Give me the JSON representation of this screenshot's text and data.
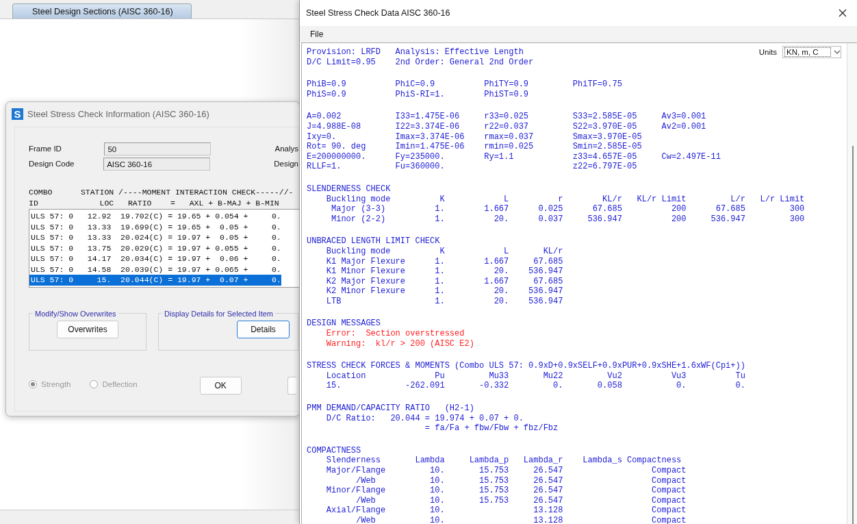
{
  "back_window": {
    "tab": {
      "label": "Steel Design Sections  (AISC 360-16)",
      "selected": true
    }
  },
  "info_dialog": {
    "app_icon": "S",
    "title": "Steel Stress Check Information (AISC 360-16)",
    "fields": [
      {
        "label": "Frame ID",
        "value": "50",
        "side_label": "Analys"
      },
      {
        "label": "Design Code",
        "value": "AISC 360-16",
        "side_label": "Design"
      }
    ],
    "table": {
      "header": [
        "COMBO      STATION /----MOMENT INTERACTION CHECK-----//-",
        "ID             LOC   RATIO    =   AXL + B-MAJ + B-MIN"
      ],
      "rows": [
        {
          "text": "ULS 57: 0   12.92  19.702(C) = 19.65 + 0.054 +     0.",
          "selected": false
        },
        {
          "text": "ULS 57: 0   13.33  19.699(C) = 19.65 +  0.05 +     0.",
          "selected": false
        },
        {
          "text": "ULS 57: 0   13.33  20.024(C) = 19.97 +  0.05 +     0.",
          "selected": false
        },
        {
          "text": "ULS 57: 0   13.75  20.029(C) = 19.97 + 0.055 +     0.",
          "selected": false
        },
        {
          "text": "ULS 57: 0   14.17  20.034(C) = 19.97 +  0.06 +     0.",
          "selected": false
        },
        {
          "text": "ULS 57: 0   14.58  20.039(C) = 19.97 + 0.065 +     0.",
          "selected": false
        },
        {
          "text": "ULS 57: 0     15.  20.044(C) = 19.97 +  0.07 +     0.",
          "selected": true
        }
      ]
    },
    "groups": [
      {
        "title": "Modify/Show Overwrites",
        "button": "Overwrites",
        "focused": false
      },
      {
        "title": "Display Details for Selected Item",
        "button": "Details",
        "focused": true
      }
    ],
    "options": {
      "disabled": true,
      "items": [
        {
          "label": "Strength",
          "selected": true
        },
        {
          "label": "Deflection",
          "selected": false
        }
      ]
    },
    "ok_button": "OK"
  },
  "data_window": {
    "title": "Steel Stress Check Data  AISC 360-16",
    "menu": [
      "File"
    ],
    "units": {
      "label": "Units",
      "value": "KN, m, C"
    },
    "report": [
      {
        "kind": "info",
        "lines": [
          "Provision: LRFD   Analysis: Effective Length",
          "D/C Limit=0.95    2nd Order: General 2nd Order"
        ]
      },
      {
        "kind": "info",
        "lines": [
          "PhiB=0.9          PhiC=0.9          PhiTY=0.9         PhiTF=0.75",
          "PhiS=0.9          PhiS-RI=1.        PhiST=0.9"
        ]
      },
      {
        "kind": "info",
        "lines": [
          "A=0.002           I33=1.475E-06     r33=0.025         S33=2.585E-05     Av3=0.001",
          "J=4.988E-08       I22=3.374E-06     r22=0.037         S22=3.970E-05     Av2=0.001",
          "Ixy=0.            Imax=3.374E-06    rmax=0.037        Smax=3.970E-05",
          "Rot= 90. deg      Imin=1.475E-06    rmin=0.025        Smin=2.585E-05",
          "E=200000000.      Fy=235000.        Ry=1.1            z33=4.657E-05     Cw=2.497E-11",
          "RLLF=1.           Fu=360000.                          z22=6.797E-05"
        ]
      },
      {
        "kind": "info",
        "heading": "SLENDERNESS CHECK",
        "lines": [
          "    Buckling mode          K            L          r        KL/r   KL/r Limit         L/r   L/r Limit",
          "     Major (3-3)          1.        1.667      0.025      67.685          200      67.685         300",
          "     Minor (2-2)          1.          20.      0.037     536.947          200     536.947         300"
        ]
      },
      {
        "kind": "info",
        "heading": "UNBRACED LENGTH LIMIT CHECK",
        "lines": [
          "    Buckling mode          K            L       KL/r",
          "    K1 Major Flexure      1.        1.667     67.685",
          "    K1 Minor Flexure      1.          20.    536.947",
          "    K2 Major Flexure      1.        1.667     67.685",
          "    K2 Minor Flexure      1.          20.    536.947",
          "    LTB                   1.          20.    536.947"
        ]
      },
      {
        "kind": "alert",
        "heading": "DESIGN MESSAGES",
        "lines": [
          "    Error:  Section overstressed",
          "    Warning:  kl/r > 200 (AISC E2)"
        ]
      },
      {
        "kind": "info",
        "heading": "STRESS CHECK FORCES & MOMENTS (Combo ULS 57: 0.9xD+0.9xSELF+0.9xPUR+0.9xSHE+1.6xWF(Cpi+))",
        "lines": [
          "    Location              Pu         Mu33       Mu22         Vu2          Vu3          Tu",
          "    15.             -262.091       -0.332         0.       0.058           0.          0."
        ]
      },
      {
        "kind": "info",
        "heading": "PMM DEMAND/CAPACITY RATIO   (H2-1)",
        "lines": [
          "    D/C Ratio:   20.044 = 19.974 + 0.07 + 0.",
          "                        = fa/Fa + fbw/Fbw + fbz/Fbz"
        ]
      },
      {
        "kind": "info",
        "heading": "COMPACTNESS",
        "lines": [
          "    Slenderness       Lambda     Lambda_p   Lambda_r    Lambda_s Compactness",
          "    Major/Flange         10.       15.753     26.547                  Compact",
          "          /Web           10.       15.753     26.547                  Compact",
          "    Minor/Flange         10.       15.753     26.547                  Compact",
          "          /Web           10.       15.753     26.547                  Compact",
          "    Axial/Flange         10.                  13.128                  Compact",
          "          /Web           10.                  13.128                  Compact"
        ]
      }
    ]
  }
}
